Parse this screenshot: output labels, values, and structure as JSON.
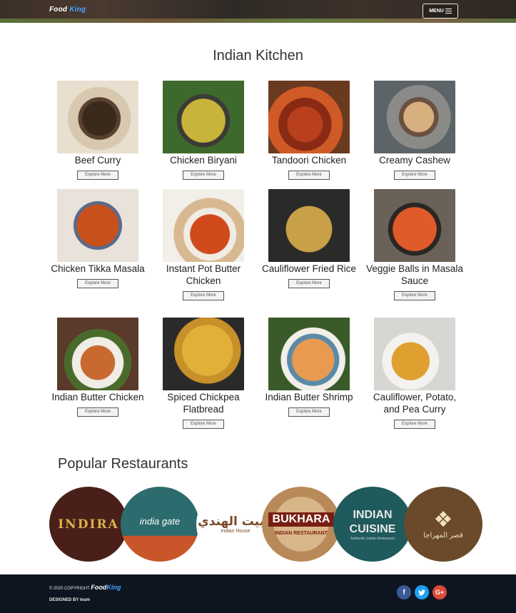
{
  "header": {
    "logo_word1": "Food",
    "logo_word2": "King",
    "menu_label": "MENU"
  },
  "kitchen": {
    "title": "Indian Kitchen",
    "explore_label": "Explore More",
    "dishes": [
      {
        "name": "Beef Curry"
      },
      {
        "name": "Chicken Biryani"
      },
      {
        "name": "Tandoori Chicken"
      },
      {
        "name": "Creamy Cashew"
      },
      {
        "name": "Chicken Tikka Masala"
      },
      {
        "name": "Instant Pot Butter Chicken"
      },
      {
        "name": "Cauliflower Fried Rice"
      },
      {
        "name": "Veggie Balls in Masala Sauce"
      },
      {
        "name": "Indian Butter Chicken"
      },
      {
        "name": "Spiced Chickpea Flatbread"
      },
      {
        "name": "Indian Butter Shrimp"
      },
      {
        "name": "Cauliflower, Potato, and Pea Curry"
      }
    ]
  },
  "restaurants": {
    "title": "Popular Restaurants",
    "logos": [
      {
        "text": "INDIRA"
      },
      {
        "text": "india gate"
      },
      {
        "text": "البيت الهندي",
        "sub": "Indian House"
      },
      {
        "text": "BUKHARA",
        "sub": "INDIAN RESTAURANT"
      },
      {
        "text": "INDIAN CUISINE",
        "sub": "Authentic Indian Restaurant"
      },
      {
        "text": "قصر المهراجا"
      }
    ]
  },
  "footer": {
    "copyright_prefix": "© 2020 COPYRIGHT",
    "brand_word1": "Food",
    "brand_word2": "King",
    "designed_by": "DESIGNED BY team",
    "social": [
      "facebook-icon",
      "twitter-icon",
      "google-plus-icon"
    ]
  }
}
